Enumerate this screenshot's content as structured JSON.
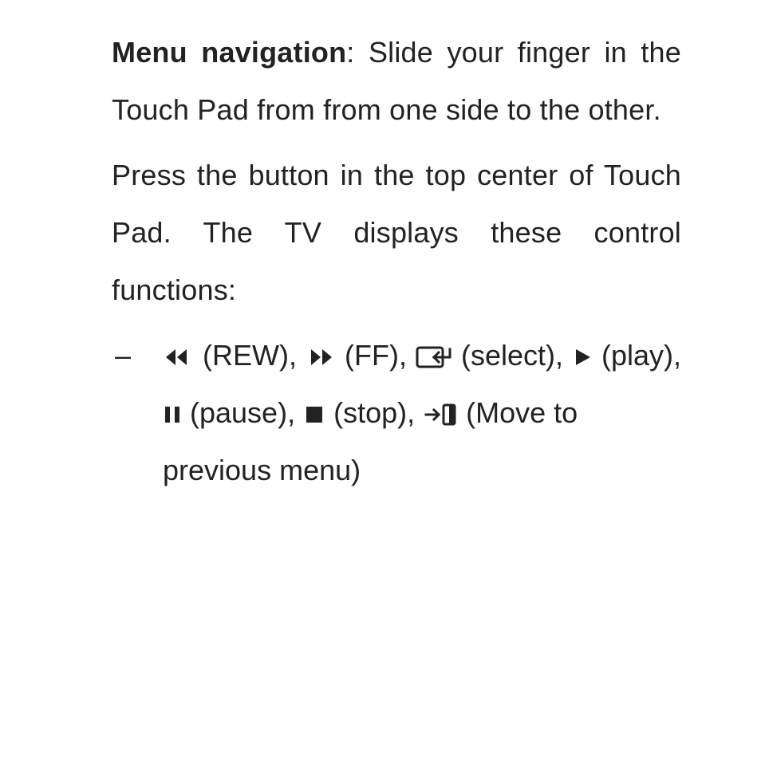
{
  "para1": {
    "bold": "Menu navigation",
    "rest": ": Slide your finger in the Touch Pad from from one side to the other."
  },
  "para2": "Press the button in the top center of Touch Pad. The TV displays these control functions:",
  "dash": "–",
  "controls": {
    "rew": " (REW), ",
    "ff": " (FF), ",
    "select": " (select), ",
    "play": " (play), ",
    "pause": " (pause), ",
    "stop": " (stop), ",
    "back": " (Move to previous menu)"
  }
}
